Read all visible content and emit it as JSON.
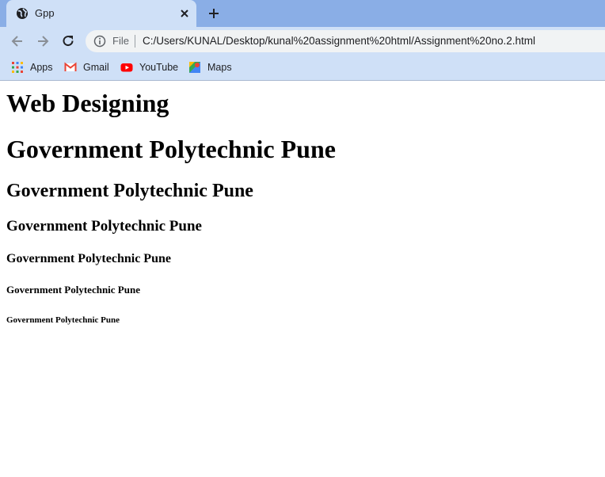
{
  "browser": {
    "tab": {
      "title": "Gpp",
      "favicon": "globe-icon"
    },
    "address_bar": {
      "scheme_label": "File",
      "url": "C:/Users/KUNAL/Desktop/kunal%20assignment%20html/Assignment%20no.2.html"
    },
    "bookmarks": [
      {
        "label": "Apps",
        "icon": "apps-grid-icon"
      },
      {
        "label": "Gmail",
        "icon": "gmail-icon"
      },
      {
        "label": "YouTube",
        "icon": "youtube-icon"
      },
      {
        "label": "Maps",
        "icon": "maps-icon"
      }
    ],
    "colors": {
      "tabstrip": "#8aaee6",
      "toolbar": "#cfe0f7",
      "omnibox": "#f1f3f4"
    }
  },
  "page": {
    "h1_first": "Web Designing",
    "h1": "Government Polytechnic Pune",
    "h2": "Government Polytechnic Pune",
    "h3": "Government Polytechnic Pune",
    "h4": "Government Polytechnic Pune",
    "h5": "Government Polytechnic Pune",
    "h6": "Government Polytechnic Pune"
  }
}
